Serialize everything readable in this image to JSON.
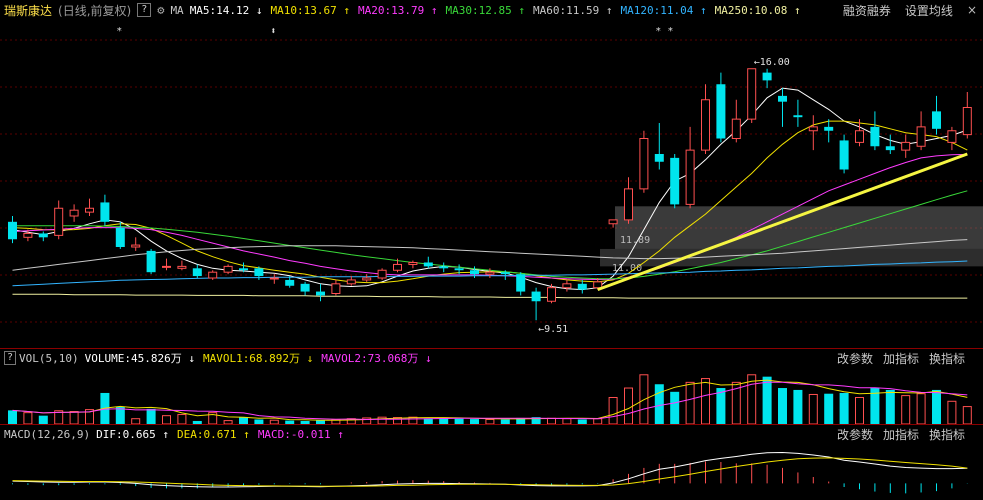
{
  "header": {
    "stock_name": "瑞斯康达",
    "period": "(日线,前复权)",
    "info_icon": "?",
    "ma_label": "MA",
    "ma_items": [
      {
        "label": "MA5:14.12",
        "arrow": "↓",
        "color": "#ffffff"
      },
      {
        "label": "MA10:13.67",
        "arrow": "↑",
        "color": "#f0e000"
      },
      {
        "label": "MA20:13.79",
        "arrow": "↑",
        "color": "#ff3cff"
      },
      {
        "label": "MA30:12.85",
        "arrow": "↑",
        "color": "#39d839"
      },
      {
        "label": "MA60:11.59",
        "arrow": "↑",
        "color": "#c8c8c8"
      },
      {
        "label": "MA120:11.04",
        "arrow": "↑",
        "color": "#32b4ff"
      },
      {
        "label": "MA250:10.08",
        "arrow": "↑",
        "color": "#f0f0a0"
      }
    ],
    "links": [
      "融资融券",
      "设置均线"
    ],
    "close": "×"
  },
  "vol_header": {
    "title": "VOL(5,10)",
    "info_icon": "?",
    "items": [
      {
        "label": "VOLUME:45.826万",
        "arrow": "↓",
        "color": "#ffffff"
      },
      {
        "label": "MAVOL1:68.892万",
        "arrow": "↓",
        "color": "#f0e000"
      },
      {
        "label": "MAVOL2:73.068万",
        "arrow": "↓",
        "color": "#ff3cff"
      }
    ],
    "links": [
      "改参数",
      "加指标",
      "换指标"
    ]
  },
  "macd_header": {
    "title": "MACD(12,26,9)",
    "items": [
      {
        "label": "DIF:0.665",
        "arrow": "↑",
        "color": "#ffffff"
      },
      {
        "label": "DEA:0.671",
        "arrow": "↑",
        "color": "#f0e000"
      },
      {
        "label": "MACD:-0.011",
        "arrow": "↑",
        "color": "#ff3cff"
      }
    ],
    "links": [
      "改参数",
      "加指标",
      "换指标"
    ]
  },
  "annotations": {
    "high_price": "16.00",
    "low_price": "9.51",
    "band_upper": "11.89",
    "band_lower": "11.00",
    "star_marks": [
      "*",
      "⬍",
      "* *"
    ]
  },
  "colors": {
    "up": "#ff5050",
    "down": "#00e5ee",
    "trend": "#f5f542"
  },
  "chart_data": {
    "type": "candlestick",
    "price_range": [
      9.0,
      17.0
    ],
    "candles": [
      [
        12.05,
        11.6,
        12.2,
        11.5
      ],
      [
        11.65,
        11.75,
        11.85,
        11.55
      ],
      [
        11.75,
        11.65,
        11.8,
        11.55
      ],
      [
        11.7,
        12.4,
        12.6,
        11.6
      ],
      [
        12.2,
        12.35,
        12.5,
        12.05
      ],
      [
        12.3,
        12.4,
        12.65,
        12.2
      ],
      [
        12.55,
        12.05,
        12.75,
        11.95
      ],
      [
        11.9,
        11.4,
        12.05,
        11.35
      ],
      [
        11.4,
        11.45,
        11.65,
        11.3
      ],
      [
        11.3,
        10.75,
        11.35,
        10.7
      ],
      [
        10.9,
        10.9,
        11.1,
        10.8
      ],
      [
        10.85,
        10.9,
        11.05,
        10.8
      ],
      [
        10.85,
        10.65,
        10.95,
        10.6
      ],
      [
        10.6,
        10.75,
        10.8,
        10.55
      ],
      [
        10.75,
        10.9,
        10.95,
        10.7
      ],
      [
        10.85,
        10.8,
        11.0,
        10.75
      ],
      [
        10.85,
        10.65,
        10.9,
        10.55
      ],
      [
        10.6,
        10.6,
        10.7,
        10.45
      ],
      [
        10.55,
        10.4,
        10.65,
        10.35
      ],
      [
        10.45,
        10.25,
        10.5,
        10.15
      ],
      [
        10.25,
        10.15,
        10.45,
        10.0
      ],
      [
        10.2,
        10.45,
        10.55,
        10.15
      ],
      [
        10.45,
        10.55,
        10.65,
        10.4
      ],
      [
        10.55,
        10.6,
        10.7,
        10.5
      ],
      [
        10.6,
        10.8,
        10.85,
        10.55
      ],
      [
        10.8,
        10.95,
        11.1,
        10.75
      ],
      [
        10.95,
        11.0,
        11.05,
        10.85
      ],
      [
        11.0,
        10.9,
        11.15,
        10.85
      ],
      [
        10.9,
        10.85,
        11.0,
        10.75
      ],
      [
        10.85,
        10.8,
        10.95,
        10.7
      ],
      [
        10.8,
        10.7,
        10.9,
        10.6
      ],
      [
        10.7,
        10.75,
        10.85,
        10.6
      ],
      [
        10.75,
        10.7,
        10.8,
        10.55
      ],
      [
        10.7,
        10.25,
        10.75,
        10.15
      ],
      [
        10.25,
        10.0,
        10.35,
        9.51
      ],
      [
        10.0,
        10.35,
        10.45,
        9.95
      ],
      [
        10.35,
        10.45,
        10.55,
        10.25
      ],
      [
        10.45,
        10.3,
        10.55,
        10.2
      ],
      [
        10.35,
        10.5,
        10.6,
        10.3
      ],
      [
        12.0,
        12.1,
        12.1,
        11.9
      ],
      [
        12.1,
        12.9,
        13.2,
        12.0
      ],
      [
        12.9,
        14.2,
        14.4,
        12.8
      ],
      [
        13.8,
        13.6,
        14.6,
        13.4
      ],
      [
        13.7,
        12.5,
        13.8,
        12.4
      ],
      [
        12.5,
        13.9,
        14.5,
        12.4
      ],
      [
        13.9,
        15.2,
        15.6,
        13.8
      ],
      [
        15.6,
        14.2,
        15.9,
        14.1
      ],
      [
        14.2,
        14.7,
        15.2,
        14.1
      ],
      [
        14.7,
        16.0,
        16.0,
        14.6
      ],
      [
        15.9,
        15.7,
        16.0,
        15.5
      ],
      [
        15.3,
        15.15,
        15.5,
        14.5
      ],
      [
        14.8,
        14.75,
        15.2,
        14.5
      ],
      [
        14.4,
        14.5,
        14.8,
        13.9
      ],
      [
        14.5,
        14.4,
        14.7,
        14.1
      ],
      [
        14.15,
        13.4,
        14.3,
        13.3
      ],
      [
        14.1,
        14.4,
        14.7,
        14.0
      ],
      [
        14.5,
        14.0,
        14.9,
        13.9
      ],
      [
        14.0,
        13.9,
        14.3,
        13.8
      ],
      [
        13.9,
        14.1,
        14.3,
        13.7
      ],
      [
        14.0,
        14.5,
        14.9,
        13.9
      ],
      [
        14.9,
        14.45,
        15.3,
        14.3
      ],
      [
        14.1,
        14.4,
        14.5,
        13.9
      ],
      [
        14.3,
        15.0,
        15.4,
        14.2
      ]
    ],
    "volumes_wan": [
      36,
      30,
      22,
      35,
      33,
      38,
      82,
      45,
      14,
      40,
      22,
      25,
      8,
      30,
      9,
      18,
      12,
      10,
      9,
      8,
      10,
      12,
      14,
      16,
      18,
      17,
      18,
      15,
      16,
      14,
      13,
      12,
      12,
      16,
      18,
      15,
      14,
      12,
      14,
      70,
      95,
      130,
      105,
      85,
      110,
      120,
      95,
      110,
      130,
      125,
      95,
      90,
      78,
      80,
      82,
      70,
      95,
      90,
      75,
      80,
      90,
      60,
      46
    ],
    "ma_lines": {
      "MA5": {
        "color": "#ffffff",
        "values": [
          11.85,
          11.78,
          11.72,
          11.8,
          11.88,
          12.0,
          12.1,
          12.05,
          11.85,
          11.55,
          11.3,
          11.1,
          10.95,
          10.85,
          10.8,
          10.78,
          10.75,
          10.72,
          10.66,
          10.55,
          10.45,
          10.4,
          10.38,
          10.4,
          10.5,
          10.65,
          10.78,
          10.85,
          10.9,
          10.88,
          10.82,
          10.77,
          10.73,
          10.62,
          10.48,
          10.38,
          10.32,
          10.3,
          10.35,
          10.65,
          11.15,
          11.85,
          12.55,
          13.1,
          13.3,
          13.65,
          14.05,
          14.4,
          14.8,
          15.25,
          15.5,
          15.45,
          15.2,
          14.95,
          14.65,
          14.5,
          14.3,
          14.15,
          14.05,
          14.12,
          14.2,
          14.28,
          14.42
        ]
      },
      "MA10": {
        "color": "#f0e000",
        "values": [
          11.9,
          11.88,
          11.85,
          11.84,
          11.85,
          11.88,
          11.95,
          12.0,
          11.98,
          11.88,
          11.7,
          11.5,
          11.3,
          11.15,
          11.02,
          10.92,
          10.86,
          10.8,
          10.75,
          10.7,
          10.62,
          10.55,
          10.5,
          10.48,
          10.48,
          10.52,
          10.58,
          10.65,
          10.7,
          10.74,
          10.75,
          10.76,
          10.76,
          10.72,
          10.66,
          10.6,
          10.55,
          10.52,
          10.5,
          10.55,
          10.72,
          11.0,
          11.3,
          11.65,
          11.95,
          12.25,
          12.6,
          12.95,
          13.3,
          13.7,
          14.05,
          14.35,
          14.55,
          14.65,
          14.65,
          14.6,
          14.55,
          14.45,
          14.35,
          14.3,
          14.25,
          14.1,
          13.9
        ]
      },
      "MA20": {
        "color": "#ff3cff",
        "values": [
          11.8,
          11.82,
          11.84,
          11.86,
          11.88,
          11.9,
          11.9,
          11.9,
          11.88,
          11.85,
          11.78,
          11.7,
          11.6,
          11.5,
          11.4,
          11.3,
          11.22,
          11.14,
          11.05,
          10.98,
          10.9,
          10.84,
          10.78,
          10.74,
          10.7,
          10.68,
          10.68,
          10.68,
          10.68,
          10.68,
          10.68,
          10.67,
          10.66,
          10.64,
          10.62,
          10.6,
          10.58,
          10.57,
          10.56,
          10.57,
          10.62,
          10.72,
          10.85,
          11.0,
          11.15,
          11.3,
          11.48,
          11.65,
          11.85,
          12.05,
          12.25,
          12.45,
          12.65,
          12.85,
          13.0,
          13.15,
          13.3,
          13.45,
          13.58,
          13.7,
          13.75,
          13.78,
          13.79
        ]
      },
      "MA30": {
        "color": "#39d839",
        "values": [
          11.95,
          11.95,
          11.95,
          11.95,
          11.95,
          11.95,
          11.94,
          11.93,
          11.91,
          11.89,
          11.86,
          11.82,
          11.78,
          11.73,
          11.68,
          11.62,
          11.56,
          11.5,
          11.44,
          11.38,
          11.32,
          11.26,
          11.2,
          11.15,
          11.1,
          11.05,
          11.0,
          10.96,
          10.92,
          10.88,
          10.84,
          10.8,
          10.76,
          10.72,
          10.68,
          10.64,
          10.62,
          10.6,
          10.58,
          10.58,
          10.6,
          10.64,
          10.7,
          10.76,
          10.84,
          10.92,
          11.0,
          11.1,
          11.2,
          11.3,
          11.42,
          11.54,
          11.66,
          11.78,
          11.9,
          12.02,
          12.14,
          12.26,
          12.38,
          12.5,
          12.62,
          12.74,
          12.85
        ]
      },
      "MA60": {
        "color": "#c8c8c8",
        "values": [
          10.8,
          10.85,
          10.9,
          10.95,
          11.0,
          11.05,
          11.1,
          11.15,
          11.2,
          11.24,
          11.28,
          11.31,
          11.34,
          11.36,
          11.38,
          11.4,
          11.41,
          11.42,
          11.43,
          11.43,
          11.43,
          11.43,
          11.42,
          11.41,
          11.4,
          11.39,
          11.38,
          11.36,
          11.34,
          11.32,
          11.3,
          11.28,
          11.26,
          11.24,
          11.22,
          11.2,
          11.18,
          11.16,
          11.14,
          11.12,
          11.11,
          11.1,
          11.1,
          11.11,
          11.12,
          11.14,
          11.16,
          11.18,
          11.2,
          11.22,
          11.24,
          11.27,
          11.3,
          11.33,
          11.36,
          11.39,
          11.42,
          11.45,
          11.48,
          11.51,
          11.54,
          11.57,
          11.59
        ]
      },
      "MA120": {
        "color": "#32b4ff",
        "values": [
          10.4,
          10.42,
          10.44,
          10.46,
          10.48,
          10.5,
          10.52,
          10.54,
          10.55,
          10.56,
          10.57,
          10.58,
          10.59,
          10.6,
          10.6,
          10.61,
          10.61,
          10.62,
          10.62,
          10.62,
          10.63,
          10.63,
          10.63,
          10.63,
          10.64,
          10.64,
          10.64,
          10.65,
          10.65,
          10.65,
          10.66,
          10.66,
          10.66,
          10.67,
          10.67,
          10.67,
          10.68,
          10.68,
          10.69,
          10.7,
          10.71,
          10.72,
          10.73,
          10.74,
          10.75,
          10.77,
          10.78,
          10.8,
          10.81,
          10.83,
          10.85,
          10.86,
          10.88,
          10.9,
          10.91,
          10.93,
          10.95,
          10.96,
          10.98,
          10.99,
          11.01,
          11.02,
          11.04
        ]
      },
      "MA250": {
        "color": "#f0f0a0",
        "values": [
          10.18,
          10.18,
          10.18,
          10.18,
          10.17,
          10.17,
          10.17,
          10.17,
          10.16,
          10.16,
          10.16,
          10.16,
          10.15,
          10.15,
          10.15,
          10.15,
          10.14,
          10.14,
          10.14,
          10.14,
          10.13,
          10.13,
          10.13,
          10.13,
          10.12,
          10.12,
          10.12,
          10.12,
          10.11,
          10.11,
          10.11,
          10.11,
          10.1,
          10.1,
          10.1,
          10.1,
          10.09,
          10.09,
          10.09,
          10.09,
          10.08,
          10.08,
          10.08,
          10.08,
          10.08,
          10.08,
          10.08,
          10.08,
          10.08,
          10.08,
          10.08,
          10.08,
          10.08,
          10.08,
          10.08,
          10.08,
          10.08,
          10.08,
          10.08,
          10.08,
          10.08,
          10.08,
          10.08
        ]
      }
    },
    "trendline": {
      "from": [
        38,
        10.3
      ],
      "to": [
        62,
        13.8
      ]
    },
    "macd": {
      "dif": [
        0.1,
        0.08,
        0.06,
        0.05,
        0.05,
        0.06,
        0.06,
        0.04,
        0.0,
        -0.06,
        -0.1,
        -0.13,
        -0.15,
        -0.16,
        -0.16,
        -0.15,
        -0.14,
        -0.13,
        -0.13,
        -0.14,
        -0.15,
        -0.13,
        -0.11,
        -0.09,
        -0.06,
        -0.03,
        -0.01,
        0.0,
        0.0,
        -0.01,
        -0.02,
        -0.03,
        -0.04,
        -0.07,
        -0.1,
        -0.11,
        -0.11,
        -0.11,
        -0.1,
        0.02,
        0.2,
        0.42,
        0.62,
        0.72,
        0.85,
        1.0,
        1.1,
        1.18,
        1.28,
        1.35,
        1.36,
        1.32,
        1.25,
        1.16,
        1.02,
        0.94,
        0.85,
        0.76,
        0.7,
        0.67,
        0.65,
        0.65,
        0.665
      ],
      "dea": [
        0.12,
        0.11,
        0.1,
        0.09,
        0.08,
        0.08,
        0.08,
        0.07,
        0.06,
        0.04,
        0.01,
        -0.02,
        -0.04,
        -0.07,
        -0.09,
        -0.1,
        -0.11,
        -0.11,
        -0.12,
        -0.12,
        -0.13,
        -0.13,
        -0.13,
        -0.12,
        -0.11,
        -0.09,
        -0.08,
        -0.06,
        -0.05,
        -0.04,
        -0.04,
        -0.04,
        -0.04,
        -0.05,
        -0.06,
        -0.07,
        -0.08,
        -0.09,
        -0.09,
        -0.07,
        -0.01,
        0.08,
        0.19,
        0.29,
        0.4,
        0.52,
        0.63,
        0.74,
        0.84,
        0.94,
        1.02,
        1.08,
        1.11,
        1.12,
        1.1,
        1.07,
        1.03,
        0.97,
        0.92,
        0.87,
        0.82,
        0.76,
        0.671
      ],
      "range": [
        -0.6,
        1.6
      ]
    }
  }
}
